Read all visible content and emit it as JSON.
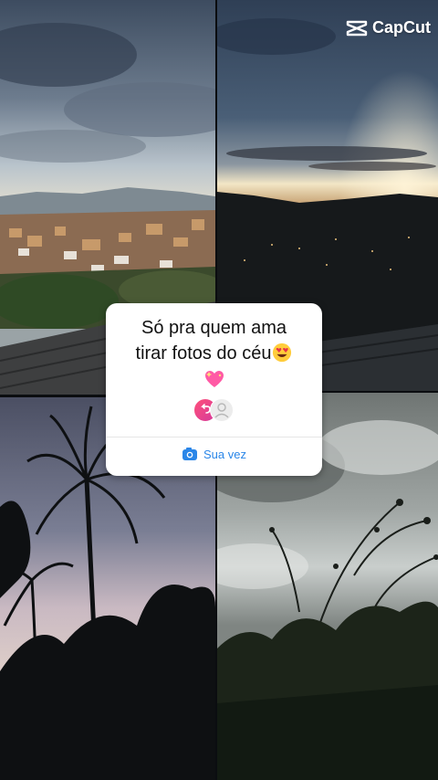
{
  "watermark": {
    "brand": "CapCut"
  },
  "sticker": {
    "line1": "Só pra quem ama",
    "line2": "tirar fotos do céu",
    "reply_label": "Sua vez"
  },
  "icons": {
    "watermark": "capcut-logo-icon",
    "emoji_1": "heart-eyes-emoji-icon",
    "emoji_2": "sparkling-heart-emoji-icon",
    "avatar_1": "reply-avatar-icon",
    "avatar_2": "placeholder-avatar-icon",
    "action": "camera-icon"
  },
  "colors": {
    "action_blue": "#2a86e8",
    "sticker_bg": "#ffffff"
  }
}
